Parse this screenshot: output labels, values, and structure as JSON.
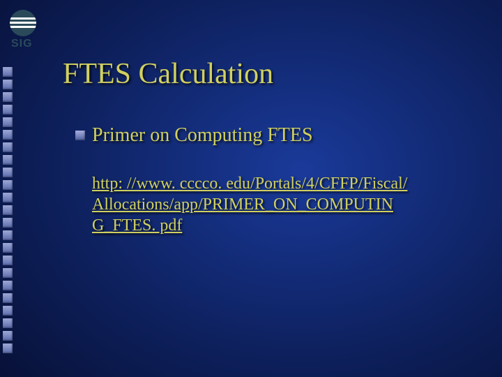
{
  "logo": {
    "label": "SIG"
  },
  "title": "FTES Calculation",
  "bullet": {
    "text": "Primer on Computing FTES"
  },
  "link": {
    "line1": "http: //www. cccco. edu/Portals/4/CFFP/Fiscal/",
    "line2": "Allocations/app/PRIMER_ON_COMPUTIN",
    "line3": "G_FTES. pdf"
  }
}
